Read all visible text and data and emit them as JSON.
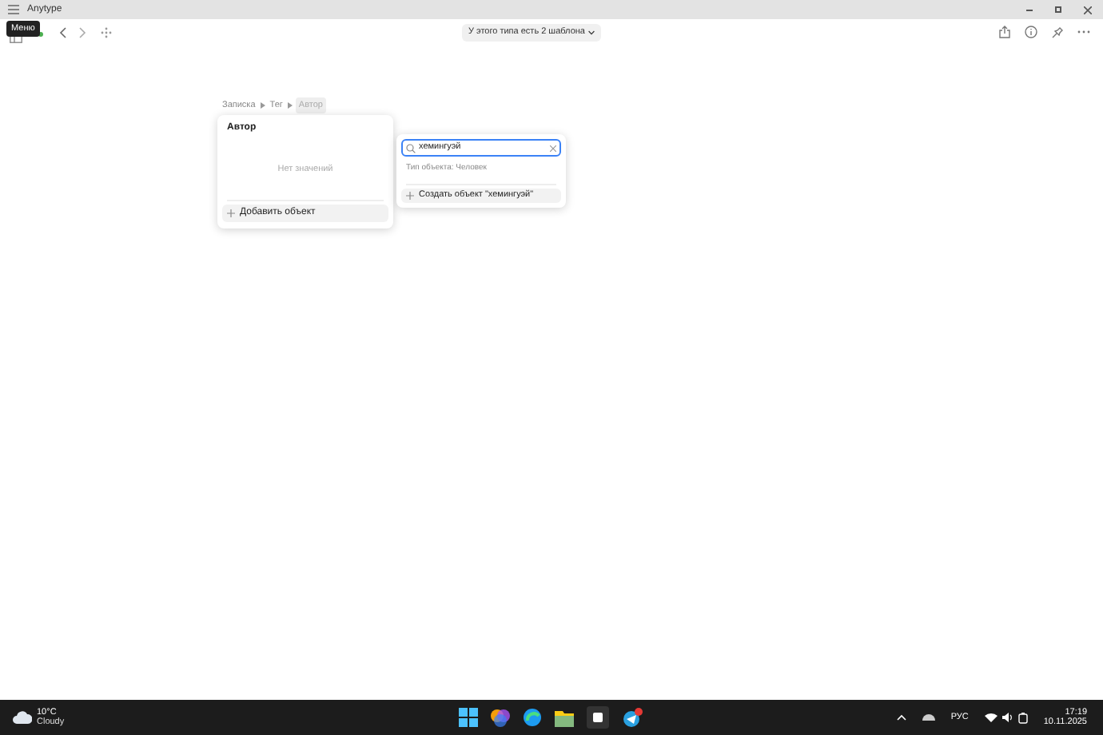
{
  "window": {
    "title": "Anytype"
  },
  "toolbar": {
    "tooltip": "Меню",
    "sync_online": true,
    "template_button": "У этого типа есть 2 шаблона"
  },
  "breadcrumb": [
    {
      "label": "Записка",
      "selected": false
    },
    {
      "label": "Тег",
      "selected": false
    },
    {
      "label": "Автор",
      "selected": true
    }
  ],
  "relation_popup": {
    "title": "Автор",
    "empty_text": "Нет значений",
    "add_button": "Добавить объект"
  },
  "search_popup": {
    "query": "хемингуэй",
    "type_filter": "Тип объекта: Человек",
    "create_button": "Создать объект \"хемингуэй\""
  },
  "taskbar": {
    "temperature": "10°C",
    "weather": "Cloudy",
    "language": "РУС",
    "time": "17:19",
    "date": "10.11.2025"
  }
}
